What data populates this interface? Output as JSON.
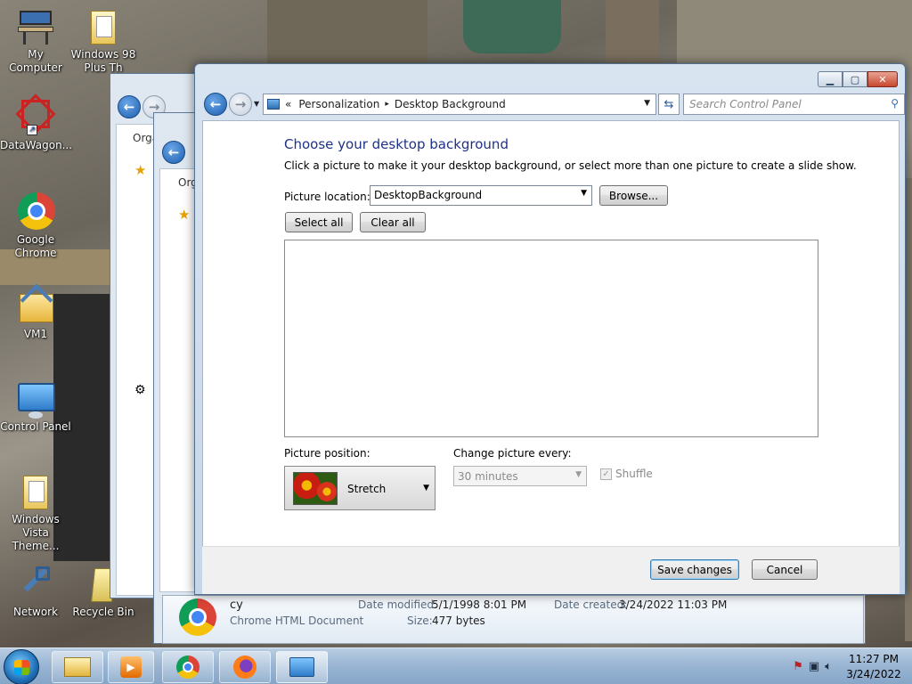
{
  "desktop": {
    "icons": [
      {
        "label": "My Computer"
      },
      {
        "label": "Windows 98 Plus Th"
      },
      {
        "label": "DataWagon..."
      },
      {
        "label": "Google Chrome"
      },
      {
        "label": "VM1"
      },
      {
        "label": "Control Panel"
      },
      {
        "label": "Windows Vista Theme..."
      },
      {
        "label": "Network"
      },
      {
        "label": "Recycle Bin"
      }
    ]
  },
  "background_windows": {
    "toolbar_label_1": "Orga",
    "toolbar_label_2": "Org"
  },
  "window": {
    "breadcrumb": {
      "chevron": "«",
      "part1": "Personalization",
      "sep": "▸",
      "part2": "Desktop Background"
    },
    "search_placeholder": "Search Control Panel",
    "heading": "Choose your desktop background",
    "subtitle": "Click a picture to make it your desktop background, or select more than one picture to create a slide show.",
    "picture_location_label": "Picture location:",
    "picture_location_value": "DesktopBackground",
    "browse_label": "Browse...",
    "select_all_label": "Select all",
    "clear_all_label": "Clear all",
    "picture_position_label": "Picture position:",
    "picture_position_value": "Stretch",
    "change_every_label": "Change picture every:",
    "change_every_value": "30 minutes",
    "shuffle_label": "Shuffle",
    "save_label": "Save changes",
    "cancel_label": "Cancel"
  },
  "details": {
    "name": "cy",
    "type": "Chrome HTML Document",
    "modified_label": "Date modified:",
    "modified_value": "5/1/1998 8:01 PM",
    "size_label": "Size:",
    "size_value": "477 bytes",
    "created_label": "Date created:",
    "created_value": "3/24/2022 11:03 PM"
  },
  "taskbar": {
    "time": "11:27 PM",
    "date": "3/24/2022"
  }
}
